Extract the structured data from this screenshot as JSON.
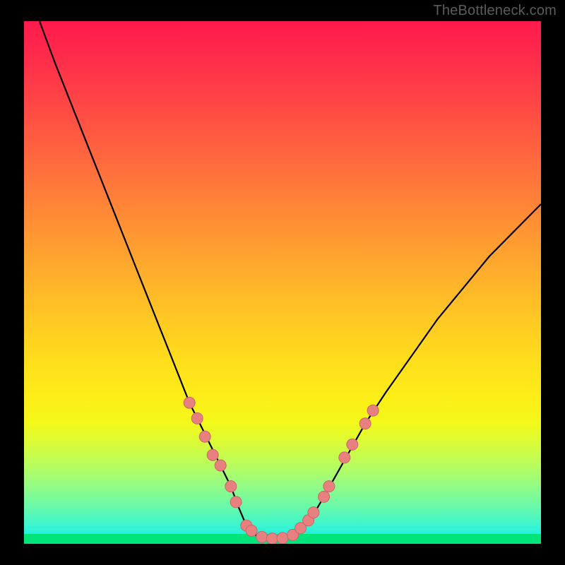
{
  "watermark": "TheBottleneck.com",
  "colors": {
    "curve": "#000000",
    "marker_fill": "#e88080",
    "marker_stroke": "#c86868",
    "green_strip": "#00e47a"
  },
  "chart_data": {
    "type": "line",
    "title": "",
    "xlabel": "",
    "ylabel": "",
    "xlim": [
      0,
      100
    ],
    "ylim": [
      0,
      100
    ],
    "series": [
      {
        "name": "bottleneck-curve",
        "x": [
          3,
          6,
          10,
          14,
          18,
          22,
          26,
          28,
          30,
          32,
          34,
          36,
          38,
          40,
          41.5,
          43,
          45,
          47,
          49,
          51,
          53,
          55,
          58,
          62,
          66,
          70,
          75,
          80,
          85,
          90,
          95,
          100
        ],
        "y": [
          100,
          92,
          82,
          72,
          62,
          52,
          42,
          37,
          32,
          27,
          23,
          19,
          15,
          11,
          7,
          3.5,
          1.5,
          1,
          1,
          1.2,
          2,
          4,
          9,
          16,
          23,
          29,
          36,
          43,
          49,
          55,
          60,
          65
        ]
      }
    ],
    "markers": [
      {
        "x": 32,
        "y": 27
      },
      {
        "x": 33.5,
        "y": 24
      },
      {
        "x": 35,
        "y": 20.5
      },
      {
        "x": 36.5,
        "y": 17
      },
      {
        "x": 38,
        "y": 15
      },
      {
        "x": 40,
        "y": 11
      },
      {
        "x": 41,
        "y": 8
      },
      {
        "x": 43,
        "y": 3.5
      },
      {
        "x": 44,
        "y": 2.5
      },
      {
        "x": 46,
        "y": 1.3
      },
      {
        "x": 48,
        "y": 1
      },
      {
        "x": 50,
        "y": 1.1
      },
      {
        "x": 52,
        "y": 1.7
      },
      {
        "x": 53.5,
        "y": 3
      },
      {
        "x": 55,
        "y": 4.5
      },
      {
        "x": 56,
        "y": 6
      },
      {
        "x": 58,
        "y": 9
      },
      {
        "x": 59,
        "y": 11
      },
      {
        "x": 62,
        "y": 16.5
      },
      {
        "x": 63.5,
        "y": 19
      },
      {
        "x": 66,
        "y": 23
      },
      {
        "x": 67.5,
        "y": 25.5
      }
    ]
  }
}
